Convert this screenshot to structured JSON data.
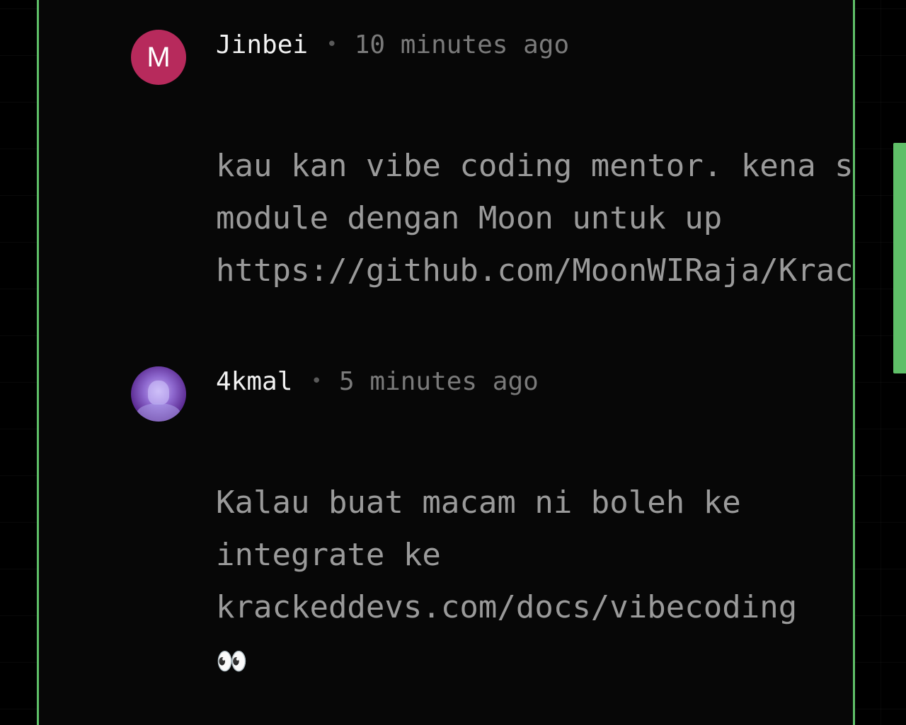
{
  "comments": [
    {
      "author": "Jinbei",
      "avatar_letter": "M",
      "avatar_color": "#b72a5c",
      "separator": "•",
      "time": "10 minutes ago",
      "body_lines": [
        "kau kan vibe coding mentor. kena st",
        "module dengan Moon untuk up",
        "https://github.com/MoonWIRaja/Krack"
      ]
    },
    {
      "author": "4kmal",
      "avatar_type": "photo",
      "separator": "•",
      "time": "5 minutes ago",
      "body_lines": [
        "Kalau buat macam ni boleh ke",
        "integrate ke",
        "krackeddevs.com/docs/vibecoding"
      ],
      "emoji": "👀"
    }
  ],
  "colors": {
    "accent": "#5fbf68",
    "panel_background": "#070707",
    "author_text": "#f2f2f2",
    "meta_text": "#7a7a7a",
    "body_text": "#9a9a9a"
  }
}
